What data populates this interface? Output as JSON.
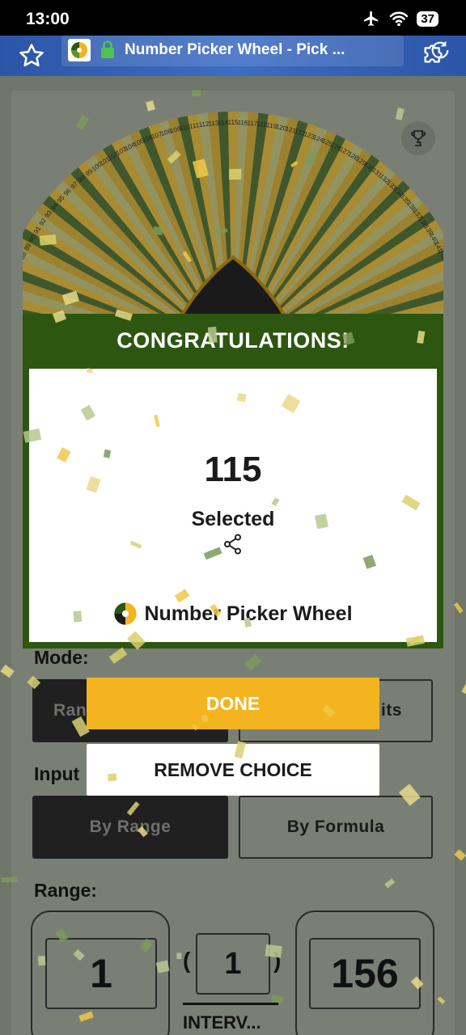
{
  "status": {
    "time": "13:00",
    "battery": "37"
  },
  "browser": {
    "title": "Number Picker Wheel - Pick ..."
  },
  "form": {
    "mode_label": "Mode:",
    "mode_options": [
      "Ran",
      "its"
    ],
    "input_label": "Input",
    "input_options": [
      "By Range",
      "By Formula"
    ],
    "range_label": "Range:",
    "range_start": "1",
    "interval": "1",
    "interval_label": "INTERV...",
    "range_end": "156"
  },
  "modal": {
    "title": "CONGRATULATIONS!",
    "result": "115",
    "result_label": "Selected",
    "brand": "Number Picker Wheel",
    "done_label": "DONE",
    "remove_label": "REMOVE CHOICE"
  },
  "wheel": {
    "visible_numbers_left": [
      "78",
      "79",
      "80",
      "81",
      "82",
      "83",
      "84",
      "85",
      "86",
      "87",
      "88",
      "89",
      "90",
      "91",
      "92",
      "93",
      "94",
      "95",
      "96",
      "97",
      "98",
      "99",
      "100",
      "101",
      "102",
      "103",
      "104",
      "105",
      "106",
      "107",
      "108",
      "109",
      "110",
      "111",
      "112",
      "113",
      "114",
      "115",
      "116",
      "117",
      "118",
      "119",
      "120",
      "121",
      "122",
      "123",
      "124",
      "125",
      "126",
      "127",
      "128",
      "129",
      "130",
      "131",
      "132",
      "133",
      "134",
      "135",
      "136",
      "137",
      "138",
      "139",
      "140",
      "141",
      "142",
      "143",
      "144",
      "145",
      "146",
      "147",
      "148",
      "149",
      "150",
      "151",
      "152"
    ],
    "colors": [
      "#2d4a14",
      "#b8901f",
      "#9c9a5a",
      "#a88318"
    ]
  },
  "colors": {
    "accent": "#f3b41f",
    "modal_green": "#2d5710"
  }
}
